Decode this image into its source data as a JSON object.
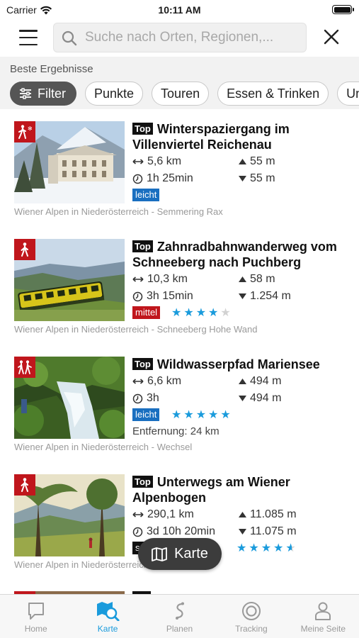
{
  "status": {
    "carrier": "Carrier",
    "time": "10:11 AM"
  },
  "search": {
    "placeholder": "Suche nach Orten, Regionen,..."
  },
  "results": {
    "title": "Beste Ergebnisse",
    "chips": [
      "Filter",
      "Punkte",
      "Touren",
      "Essen & Trinken",
      "Un"
    ]
  },
  "items": [
    {
      "top_badge": "Top",
      "title": "Winterspaziergang im Villenviertel Reichenau",
      "distance": "5,6 km",
      "duration": "1h 25min",
      "ascent": "55 m",
      "descent": "55 m",
      "difficulty": "leicht",
      "rating": 0,
      "region": "Wiener Alpen in Niederösterreich - Semmering Rax",
      "category_icon": "winter-hiking-icon"
    },
    {
      "top_badge": "Top",
      "title": "Zahnradbahnwanderweg vom Schneeberg nach Puchberg",
      "distance": "10,3 km",
      "duration": "3h 15min",
      "ascent": "58 m",
      "descent": "1.254 m",
      "difficulty": "mittel",
      "rating": 4,
      "region": "Wiener Alpen in Niederösterreich - Schneeberg Hohe Wand",
      "category_icon": "hiking-icon"
    },
    {
      "top_badge": "Top",
      "title": "Wildwasserpfad Mariensee",
      "distance": "6,6 km",
      "duration": "3h",
      "ascent": "494 m",
      "descent": "494 m",
      "difficulty": "leicht",
      "rating": 5,
      "extra": "Entfernung: 24 km",
      "region": "Wiener Alpen in Niederösterreich - Wechsel",
      "category_icon": "family-hiking-icon"
    },
    {
      "top_badge": "Top",
      "title": "Unterwegs am Wiener Alpenbogen",
      "distance": "290,1 km",
      "duration": "3d 10h 20min",
      "ascent": "11.085 m",
      "descent": "11.075 m",
      "difficulty": "schwer",
      "rating": 4.5,
      "region": "Wiener Alpen in Niederösterreich",
      "category_icon": "hiking-icon"
    }
  ],
  "map_button": {
    "label": "Karte"
  },
  "tabbar": {
    "tabs": [
      {
        "label": "Home",
        "icon": "speech-bubble-icon"
      },
      {
        "label": "Karte",
        "icon": "map-search-icon",
        "active": true
      },
      {
        "label": "Planen",
        "icon": "route-icon"
      },
      {
        "label": "Tracking",
        "icon": "record-icon"
      },
      {
        "label": "Meine Seite",
        "icon": "user-icon"
      }
    ]
  },
  "colors": {
    "accent": "#1a9bdc",
    "brand_red": "#c0161c",
    "easy": "#1a6fc0"
  }
}
